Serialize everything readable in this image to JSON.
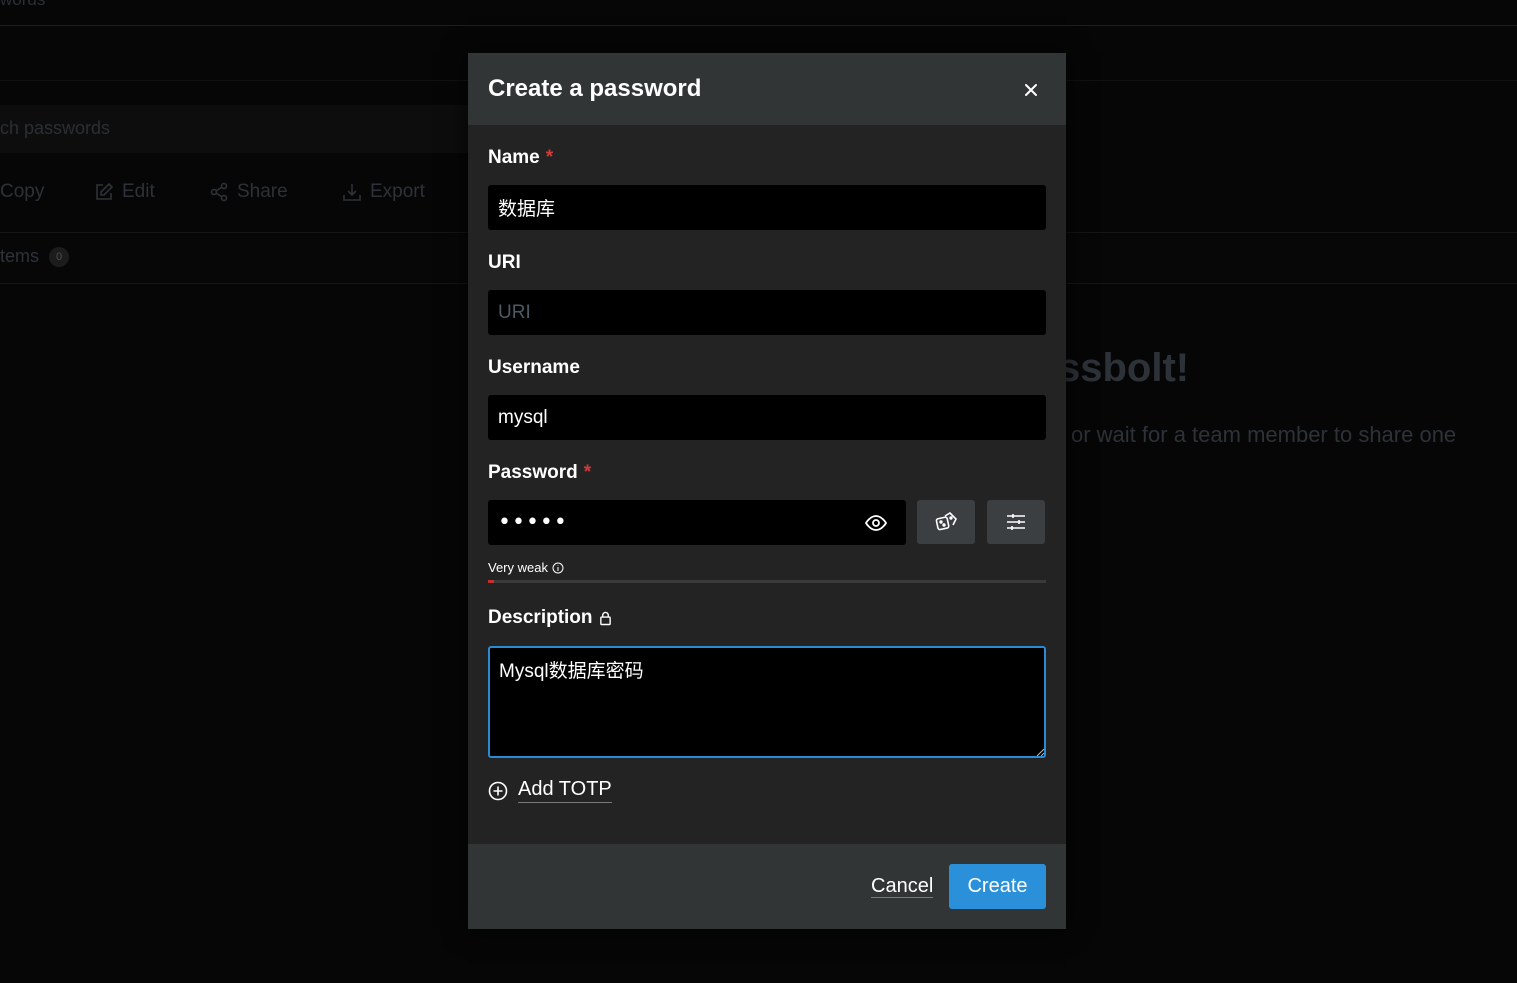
{
  "background": {
    "header_title": "words",
    "search_placeholder": "ch passwords",
    "toolbar": [
      {
        "label": "Copy",
        "icon": "copy-icon"
      },
      {
        "label": "Edit",
        "icon": "edit-icon"
      },
      {
        "label": "Share",
        "icon": "share-icon"
      },
      {
        "label": "Export",
        "icon": "export-icon"
      }
    ],
    "items_label": "tems",
    "items_count": "0",
    "welcome": "ssbolt!",
    "welcome_sub": "or wait for a team member to share one"
  },
  "modal": {
    "title": "Create a password",
    "close_icon": "close-icon",
    "name": {
      "label": "Name",
      "required_mark": "*",
      "value": "数据库"
    },
    "uri": {
      "label": "URI",
      "placeholder": "URI",
      "value": ""
    },
    "username": {
      "label": "Username",
      "value": "mysql"
    },
    "password": {
      "label": "Password",
      "required_mark": "*",
      "value": "•••••",
      "strength_label": "Very weak",
      "strength_fraction": 0.01,
      "strength_color": "#c52f2f"
    },
    "description": {
      "label": "Description",
      "value": "Mysql数据库密码"
    },
    "add_totp": "Add TOTP",
    "cancel": "Cancel",
    "create": "Create",
    "accent_color": "#2b90da"
  }
}
